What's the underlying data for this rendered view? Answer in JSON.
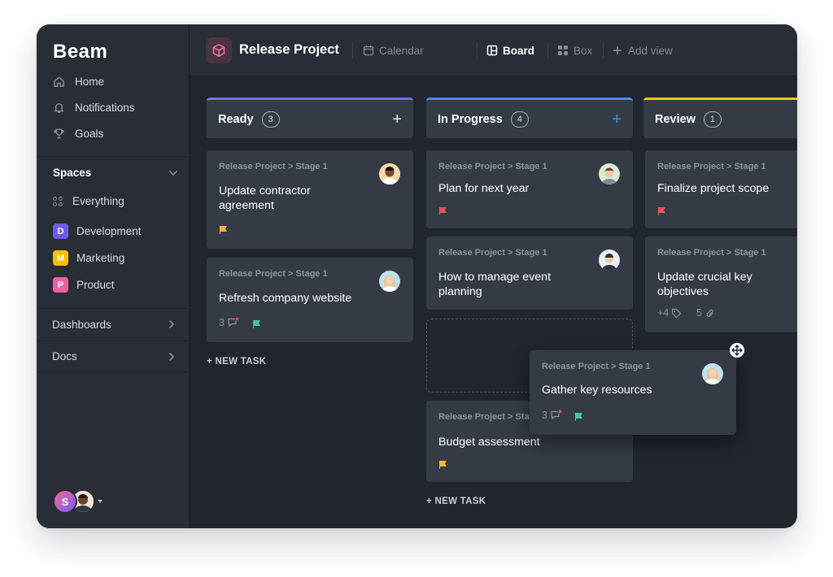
{
  "app": {
    "logo": "Beam"
  },
  "sidebar": {
    "nav": [
      {
        "label": "Home",
        "icon": "home-icon"
      },
      {
        "label": "Notifications",
        "icon": "bell-icon"
      },
      {
        "label": "Goals",
        "icon": "trophy-icon"
      }
    ],
    "spaces_title": "Spaces",
    "spaces": [
      {
        "label": "Everything",
        "badge": "",
        "color": ""
      },
      {
        "label": "Development",
        "badge": "D",
        "color": "#6e5ae8"
      },
      {
        "label": "Marketing",
        "badge": "M",
        "color": "#f5c000"
      },
      {
        "label": "Product",
        "badge": "P",
        "color": "#f25ea2"
      }
    ],
    "sections": [
      {
        "label": "Dashboards"
      },
      {
        "label": "Docs"
      }
    ],
    "user_initial": "S"
  },
  "topbar": {
    "project_title": "Release Project",
    "views": [
      {
        "label": "Calendar",
        "icon": "calendar-icon"
      },
      {
        "label": "Board",
        "icon": "board-icon"
      },
      {
        "label": "Box",
        "icon": "box-icon"
      },
      {
        "label": "Add view",
        "icon": "plus-icon"
      }
    ]
  },
  "board": {
    "columns": [
      {
        "title": "Ready",
        "count": "3",
        "accent": "#7b6cf0",
        "plus": "+"
      },
      {
        "title": "In Progress",
        "count": "4",
        "accent": "#3d8cf5",
        "plus": "+"
      },
      {
        "title": "Review",
        "count": "1",
        "accent": "#f5c800",
        "plus": ""
      }
    ],
    "new_task_label": "+ NEW TASK",
    "cards": {
      "c1": {
        "path": "Release Project > Stage 1",
        "title": "Update contractor agreement",
        "flag": "#f3b53c"
      },
      "c2": {
        "path": "Release Project > Stage 1",
        "title": "Refresh company website",
        "comments": "3",
        "flag": "#3ecaa1"
      },
      "c3": {
        "path": "Release Project > Stage 1",
        "title": "Plan for next year",
        "flag": "#f04e5b"
      },
      "c4": {
        "path": "Release Project > Stage 1",
        "title": "How to manage event planning"
      },
      "c5": {
        "path": "Release Project > Sta",
        "title": "Budget assessment",
        "flag": "#f3b53c"
      },
      "c6": {
        "path": "Release Project > Stage 1",
        "title": "Finalize project scope",
        "flag": "#f04e5b"
      },
      "c7": {
        "path": "Release Project > Stage 1",
        "title": "Update crucial key objectives",
        "tags": "+4",
        "attachments": "5"
      },
      "drag": {
        "path": "Release Project > Stage 1",
        "title": "Gather key resources",
        "comments": "3",
        "flag": "#3ecaa1"
      }
    }
  }
}
